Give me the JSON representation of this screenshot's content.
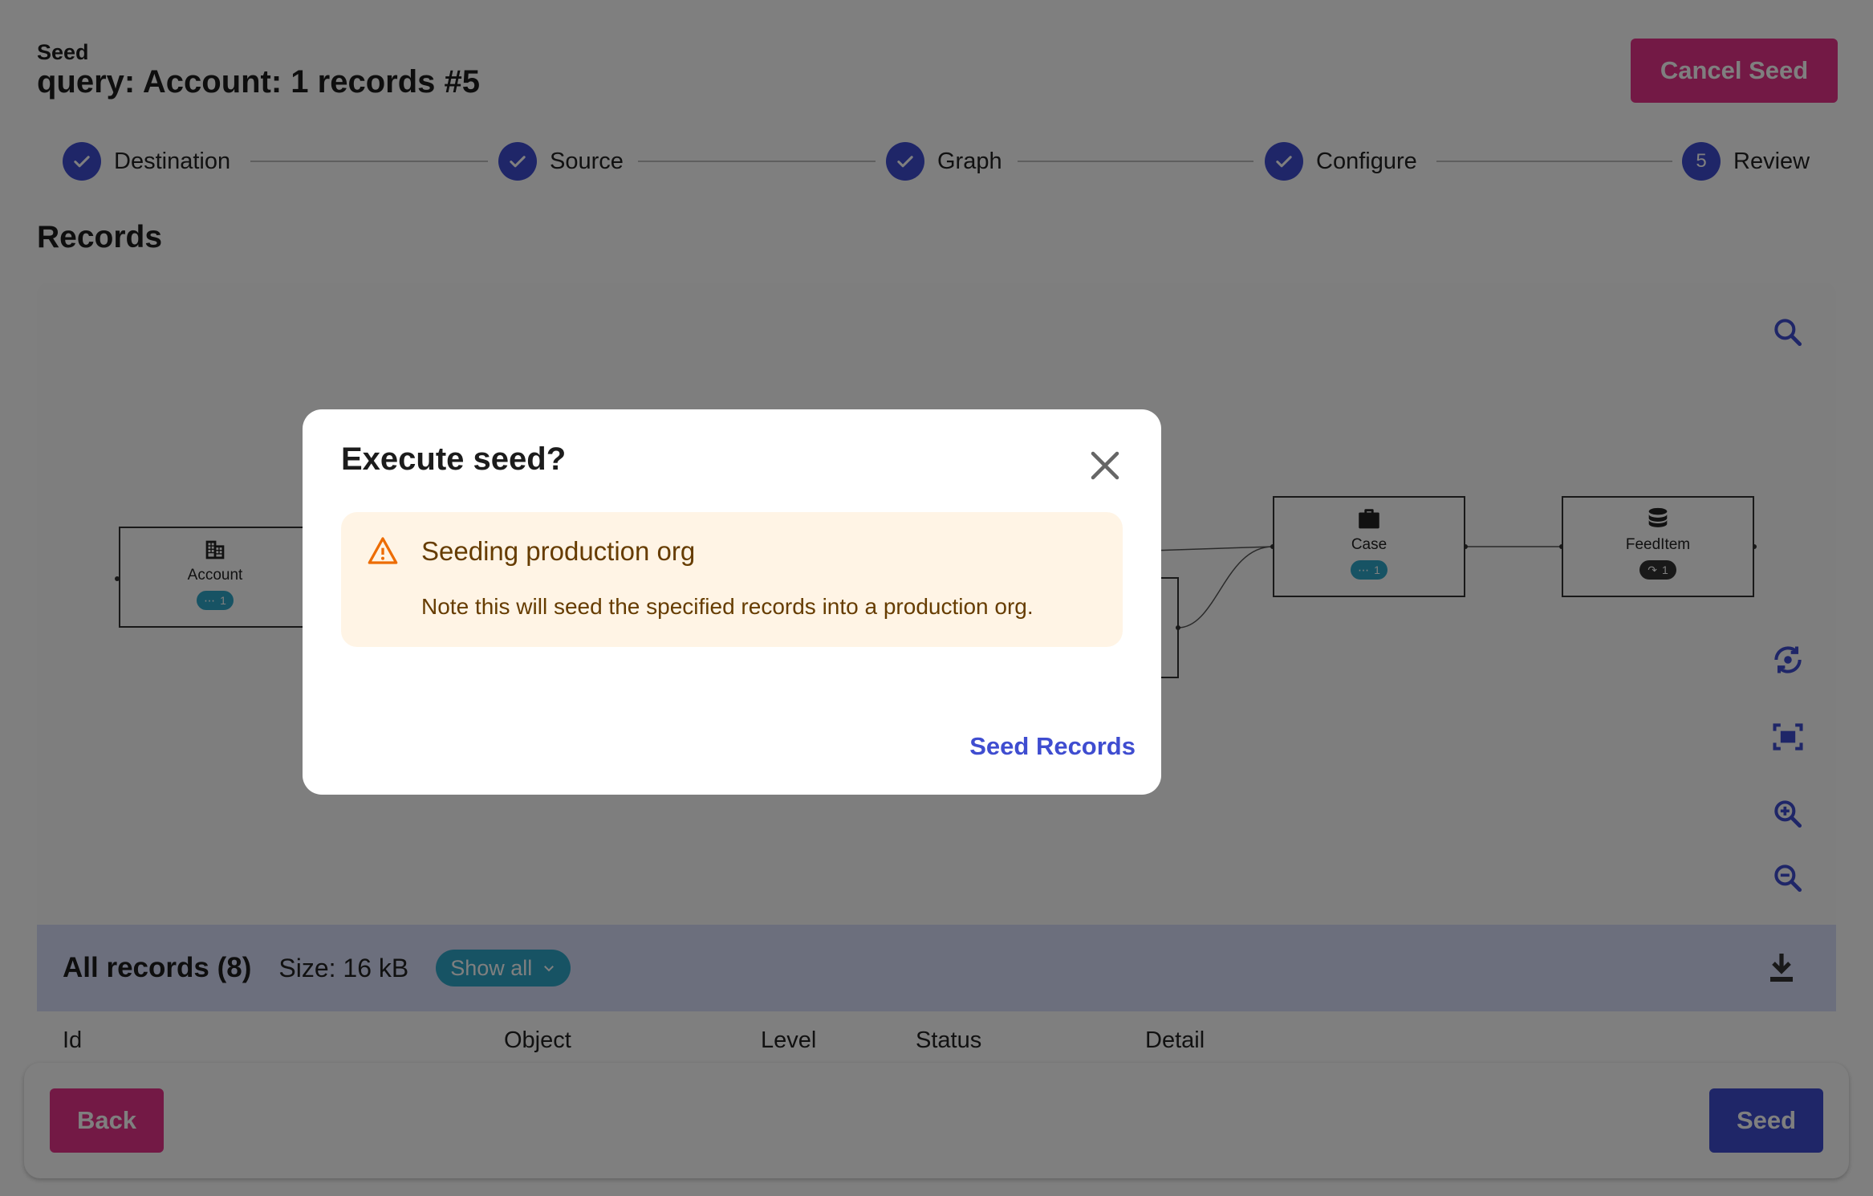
{
  "header": {
    "eyebrow": "Seed",
    "title": "query: Account: 1 records #5",
    "cancel_label": "Cancel Seed"
  },
  "stepper": {
    "steps": [
      {
        "label": "Destination",
        "state": "complete"
      },
      {
        "label": "Source",
        "state": "complete"
      },
      {
        "label": "Graph",
        "state": "complete"
      },
      {
        "label": "Configure",
        "state": "complete"
      },
      {
        "label": "Review",
        "state": "current",
        "number": "5"
      }
    ]
  },
  "records_section": {
    "title": "Records",
    "graph": {
      "nodes": [
        {
          "label": "Account",
          "icon": "building-icon",
          "badge": "1",
          "badge_icon": "ellipsis-icon",
          "badge_color": "#2fa7c8"
        },
        {
          "label": "Case",
          "icon": "briefcase-icon",
          "badge": "1",
          "badge_icon": "ellipsis-icon",
          "badge_color": "#2fa7c8"
        },
        {
          "label": "FeedItem",
          "icon": "database-icon",
          "badge": "1",
          "badge_icon": "redo-icon",
          "badge_color": "#333333"
        }
      ]
    },
    "toolbar": [
      "search-icon",
      "reset-view-icon",
      "fit-screen-icon",
      "zoom-in-icon",
      "zoom-out-icon"
    ]
  },
  "records_bar": {
    "title": "All records (8)",
    "size": "Size: 16 kB",
    "filter_value": "Show all"
  },
  "table": {
    "columns": [
      "Id",
      "Object",
      "Level",
      "Status",
      "Detail"
    ]
  },
  "footer": {
    "back_label": "Back",
    "seed_label": "Seed"
  },
  "modal": {
    "title": "Execute seed?",
    "alert": {
      "title": "Seeding production org",
      "body": "Note this will seed the specified records into a production org."
    },
    "action_label": "Seed Records"
  },
  "colors": {
    "primary": "#3f4dd0",
    "accent": "#e6338a",
    "teal": "#2fa7c8",
    "warning_bg": "#fff4e5",
    "warning_text": "#663c00",
    "warning_icon": "#ed6c02"
  }
}
